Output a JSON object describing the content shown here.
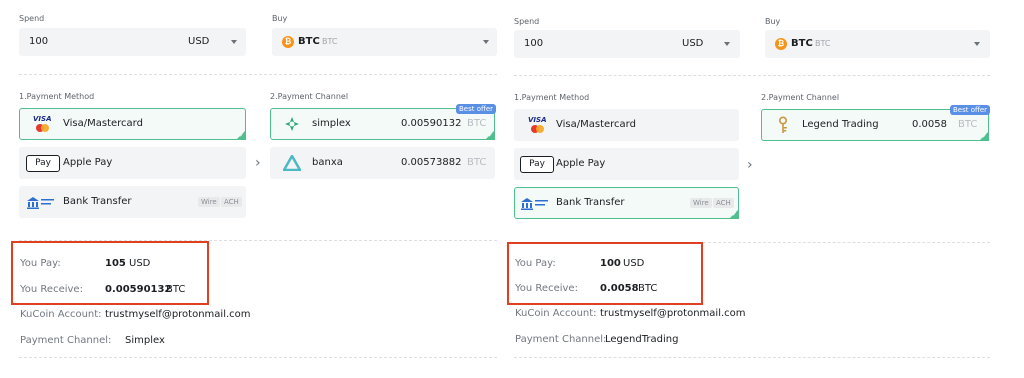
{
  "left": {
    "spend": {
      "label": "Spend",
      "amount": "100",
      "currency": "USD"
    },
    "buy": {
      "label": "Buy",
      "symbol": "BTC",
      "sub": "BTC"
    },
    "payment_method_label": "1.Payment Method",
    "payment_channel_label": "2.Payment Channel",
    "methods": {
      "visa": "Visa/Mastercard",
      "apple": "Apple Pay",
      "apple_icon_text": "Pay",
      "bank": "Bank Transfer",
      "bank_tags": [
        "Wire",
        "ACH"
      ]
    },
    "channels": {
      "badge": "Best offer",
      "c1": {
        "name": "simplex",
        "amount": "0.00590132",
        "currency": "BTC"
      },
      "c2": {
        "name": "banxa",
        "amount": "0.00573882",
        "currency": "BTC"
      }
    },
    "summary": {
      "pay_label": "You Pay:",
      "pay_value": "105",
      "pay_cur": "USD",
      "receive_label": "You Receive:",
      "receive_value": "0.00590132",
      "receive_cur": "BTC",
      "account_label": "KuCoin Account:",
      "account_value": "trustmyself@protonmail.com",
      "channel_label": "Payment Channel:",
      "channel_value": "Simplex"
    }
  },
  "right": {
    "spend": {
      "label": "Spend",
      "amount": "100",
      "currency": "USD"
    },
    "buy": {
      "label": "Buy",
      "symbol": "BTC",
      "sub": "BTC"
    },
    "payment_method_label": "1.Payment Method",
    "payment_channel_label": "2.Payment Channel",
    "methods": {
      "visa": "Visa/Mastercard",
      "apple": "Apple Pay",
      "apple_icon_text": "Pay",
      "bank": "Bank Transfer",
      "bank_tags": [
        "Wire",
        "ACH"
      ]
    },
    "channels": {
      "badge": "Best offer",
      "c1": {
        "name": "Legend Trading",
        "amount": "0.0058",
        "currency": "BTC"
      }
    },
    "summary": {
      "pay_label": "You Pay:",
      "pay_value": "100",
      "pay_cur": "USD",
      "receive_label": "You Receive:",
      "receive_value": "0.0058",
      "receive_cur": "BTC",
      "account_label": "KuCoin Account:",
      "account_value": "trustmyself@protonmail.com",
      "channel_label": "Payment Channel:",
      "channel_value": "LegendTrading"
    }
  },
  "colors": {
    "accent_green": "#4fbf8e",
    "badge_blue": "#5a8fe6",
    "highlight_red": "#e0401f",
    "btc_orange": "#f7931a"
  },
  "icons": [
    "visa-mastercard-icon",
    "apple-pay-icon",
    "bank-transfer-icon",
    "simplex-icon",
    "banxa-icon",
    "legend-trading-key-icon",
    "btc-coin-icon",
    "chevron-down-icon",
    "chevron-right-icon"
  ]
}
